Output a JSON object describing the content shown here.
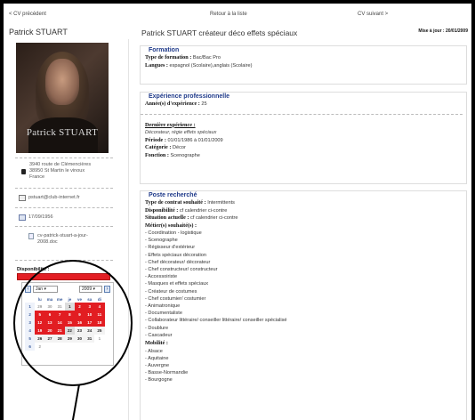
{
  "nav": {
    "prev": "< CV précédent",
    "back": "Retour à la liste",
    "next": "CV suivant >"
  },
  "candidate": {
    "name": "Patrick STUART",
    "cv_title": "Patrick STUART créateur déco effets spéciaux",
    "updated": "Mise à jour : 20/01/2009",
    "photo_caption": "Patrick STUART"
  },
  "sidebar": {
    "address": [
      "3940 route de Clémencières",
      "38950 St Martin le vinoux",
      "France"
    ],
    "email": "pstuart@club-internet.fr",
    "birthdate": "17/09/1956",
    "file": [
      "cv-patrick-stuart-a-jour-",
      "2008.doc"
    ],
    "availability_label": "Disponibilité :"
  },
  "calendar": {
    "month": "Jan",
    "year": "2009",
    "headers": [
      "",
      "lu",
      "ma",
      "me",
      "je",
      "ve",
      "sa",
      "di"
    ],
    "weeks": [
      [
        {
          "t": "1",
          "c": "wk"
        },
        {
          "t": "29",
          "c": "o"
        },
        {
          "t": "30",
          "c": "o"
        },
        {
          "t": "31",
          "c": "o"
        },
        {
          "t": "1",
          "c": "wkwe"
        },
        {
          "t": "2",
          "c": "r"
        },
        {
          "t": "3",
          "c": "r"
        },
        {
          "t": "4",
          "c": "r"
        }
      ],
      [
        {
          "t": "2",
          "c": "wk"
        },
        {
          "t": "5",
          "c": "r"
        },
        {
          "t": "6",
          "c": "r"
        },
        {
          "t": "7",
          "c": "r"
        },
        {
          "t": "8",
          "c": "r"
        },
        {
          "t": "9",
          "c": "r"
        },
        {
          "t": "10",
          "c": "r"
        },
        {
          "t": "11",
          "c": "r"
        }
      ],
      [
        {
          "t": "3",
          "c": "wk"
        },
        {
          "t": "12",
          "c": "r"
        },
        {
          "t": "13",
          "c": "r"
        },
        {
          "t": "14",
          "c": "r"
        },
        {
          "t": "15",
          "c": "r"
        },
        {
          "t": "16",
          "c": "r"
        },
        {
          "t": "17",
          "c": "r"
        },
        {
          "t": "18",
          "c": "r"
        }
      ],
      [
        {
          "t": "4",
          "c": "wk"
        },
        {
          "t": "19",
          "c": "r"
        },
        {
          "t": "20",
          "c": "r"
        },
        {
          "t": "21",
          "c": "r"
        },
        {
          "t": "22",
          "c": "wkwe"
        },
        {
          "t": "23",
          "c": "n"
        },
        {
          "t": "24",
          "c": "n"
        },
        {
          "t": "25",
          "c": "n"
        }
      ],
      [
        {
          "t": "5",
          "c": "wk"
        },
        {
          "t": "26",
          "c": "n"
        },
        {
          "t": "27",
          "c": "n"
        },
        {
          "t": "28",
          "c": "n"
        },
        {
          "t": "29",
          "c": "n"
        },
        {
          "t": "30",
          "c": "n"
        },
        {
          "t": "31",
          "c": "n"
        },
        {
          "t": "1",
          "c": "o"
        }
      ],
      [
        {
          "t": "6",
          "c": "wk"
        },
        {
          "t": "2",
          "c": "o"
        },
        {
          "t": "",
          "c": "o"
        },
        {
          "t": "",
          "c": "o"
        },
        {
          "t": "",
          "c": "o"
        },
        {
          "t": "",
          "c": "o"
        },
        {
          "t": "",
          "c": "o"
        },
        {
          "t": "",
          "c": "o"
        }
      ]
    ]
  },
  "formation": {
    "title": "Formation",
    "type_label": "Type de formation :",
    "type_value": "Bac/Bac Pro",
    "lang_label": "Langues :",
    "lang_value": "espagnol (Scolaire),anglais (Scolaire)"
  },
  "experience": {
    "title": "Expérience professionnelle",
    "years_label": "Année(s) d'expérience :",
    "years_value": "25",
    "last_label": "Dernière expérience :",
    "last_value": "Décorateur, régie effets spéciaux",
    "period_label": "Période :",
    "period_value": "01/01/1986 à 01/01/2009",
    "cat_label": "Catégorie :",
    "cat_value": "Décor",
    "func_label": "Fonction :",
    "func_value": "Scenographe"
  },
  "poste": {
    "title": "Poste recherché",
    "contract_label": "Type de contrat souhaité :",
    "contract_value": "Intermittents",
    "dispo_label": "Disponibilité :",
    "dispo_value": "cf calendrier ci-contre",
    "situation_label": "Situation actuelle :",
    "situation_value": "cf calendrier ci-contre",
    "jobs_label": "Métier(s) souhaité(s) :",
    "jobs": [
      "- Coordination - logistique",
      "- Scenographe",
      "- Régisseur d'extérieur",
      "- Effets spéciaux décoration",
      "- Chef décorateur/ décorateur",
      "- Chef constructeur/ constructeur",
      "- Accessoiriste",
      "- Masques et effets spéciaux",
      "- Créateur de costumes",
      "- Chef costumier/ costumier",
      "- Animatronique",
      "- Documentaliste",
      "- Collaborateur littéraire/ conseiller littéraire/ conseiller spécialisé",
      "- Doublure",
      "- Cascadeur"
    ],
    "mobility_label": "Mobilité :",
    "mobility": [
      "- Alsace",
      "- Aquitaine",
      "- Auvergne",
      "- Basse-Normandie",
      "- Bourgogne"
    ]
  }
}
